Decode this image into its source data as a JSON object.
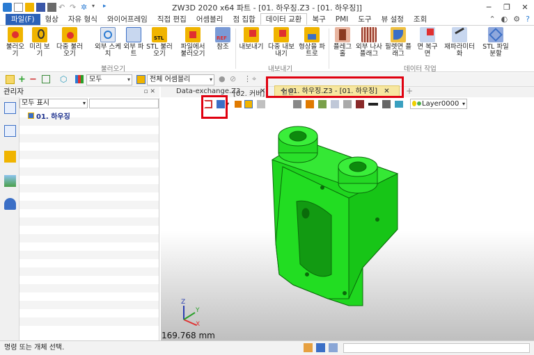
{
  "title_bar": {
    "title": "ZW3D 2020 x64        파트 - [01. 하우징.Z3 - [01. 하우징]]",
    "minimize": "─",
    "restore": "❐",
    "close": "✕"
  },
  "ribbon_tabs": [
    {
      "label": "파일(F)"
    },
    {
      "label": "형상"
    },
    {
      "label": "자유 형식"
    },
    {
      "label": "와이어프레임"
    },
    {
      "label": "직접 편집"
    },
    {
      "label": "어셈블리"
    },
    {
      "label": "점 집합"
    },
    {
      "label": "데이터 교환"
    },
    {
      "label": "복구"
    },
    {
      "label": "PMI"
    },
    {
      "label": "도구"
    },
    {
      "label": "뷰 설정"
    },
    {
      "label": "조회"
    }
  ],
  "ribbon": {
    "buttons": [
      {
        "label": "불러오기"
      },
      {
        "label": "미리 보기"
      },
      {
        "label": "다중 불러오기"
      },
      {
        "label": "외부 스케치"
      },
      {
        "label": "외부 파트"
      },
      {
        "label": "STL 불러오기"
      },
      {
        "label": "파일에서 불러오기"
      },
      {
        "label": "참조"
      },
      {
        "label": "내보내기"
      },
      {
        "label": "다중 내보내기"
      },
      {
        "label": "형상을 파트로"
      },
      {
        "label": "플레그 홀"
      },
      {
        "label": "외부 나사 플래그"
      },
      {
        "label": "필렛면 플래그"
      },
      {
        "label": "면 복구 면"
      },
      {
        "label": "재파라미터화"
      },
      {
        "label": "STL 파일 분할"
      }
    ],
    "groups": {
      "import": "불러오기",
      "export": "내보내기",
      "data_work": "데이터 작업"
    }
  },
  "toolbar": {
    "filter_value": "모두",
    "assembly_value": "전체 어셈블리"
  },
  "manager": {
    "title": "관리자",
    "show_filter": "모두 표시",
    "tree_root": "01. 하우징"
  },
  "doc_tabs": {
    "tab1": "Data-exchange.Z3",
    "tab2": "[02. 커버]",
    "active": "01. 하우징.Z3 - [01. 하우징]",
    "add": "+"
  },
  "viewport": {
    "layer": "Layer0000",
    "view_mode": "일반",
    "scale_text": "169.768 mm",
    "axis_x": "X",
    "axis_y": "Y",
    "axis_z": "Z"
  },
  "status": {
    "message": "명령 또는 개체 선택."
  },
  "colors": {
    "part": "#1fd61f",
    "part_edge": "#0a6b0a",
    "highlight": "#e0000f",
    "file_tab": "#2b62b8"
  }
}
